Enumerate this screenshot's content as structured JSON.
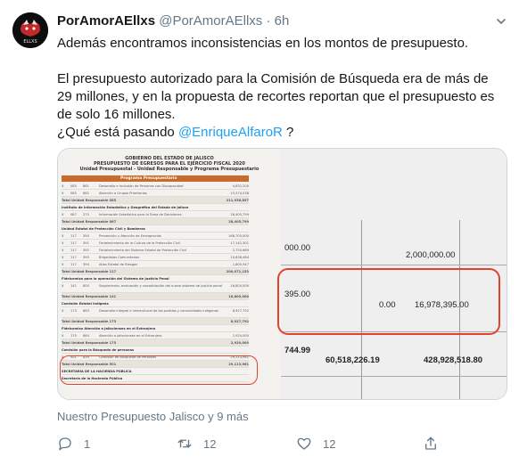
{
  "tweet": {
    "display_name": "PorAmorAEllxs",
    "handle": "@PorAmorAEllxs",
    "separator": "·",
    "time": "6h",
    "avatar_text": "ELLXS",
    "text_line1": "Además encontramos inconsistencias en los montos de presupuesto.",
    "text_line2": "El presupuesto autorizado para la Comisión de Búsqueda era de más de 29 millones, y en la propuesta de recortes reportan que el presupuesto es de solo 16 millones.",
    "text_line3_prefix": "¿Qué está pasando ",
    "mention": "@EnriqueAlfaroR",
    "text_line3_suffix": " ?",
    "footer": "Nuestro Presupuesto Jalisco y 9 más",
    "replies": "1",
    "retweets": "12",
    "likes": "12"
  },
  "document": {
    "title1": "GOBIERNO DEL ESTADO DE JALISCO",
    "title2": "PRESUPUESTO DE EGRESOS PARA EL EJERCICIO FISCAL 2020",
    "title3": "Unidad Presupuestal - Unidad Responsable y Programa Presupuestario",
    "col_header": "Programa Presupuestario",
    "rows": [
      {
        "a": "X",
        "b": "085",
        "c": "861",
        "d": "Desarrollo e Inclusión de Personas con Discapacidad",
        "e": "4,632,200"
      },
      {
        "a": "X",
        "b": "085",
        "c": "862",
        "d": "Atención a Grupos Prioritarios",
        "e": "15,574,538"
      },
      {
        "a": "",
        "b": "",
        "c": "",
        "d": "Total Unidad Responsable 085",
        "e": "211,936,897",
        "type": "total"
      },
      {
        "a": "",
        "b": "",
        "c": "",
        "d": "Instituto de Información Estadística y Geográfica del Estado de Jalisco",
        "e": "",
        "type": "sect"
      },
      {
        "a": "X",
        "b": "087",
        "c": "270",
        "d": "Información Estadística para la Toma de Decisiones",
        "e": "28,405,799"
      },
      {
        "a": "",
        "b": "",
        "c": "",
        "d": "Total Unidad Responsable 087",
        "e": "28,405,799",
        "type": "total"
      },
      {
        "a": "",
        "b": "",
        "c": "",
        "d": "Unidad Estatal de Protección Civil y Bomberos",
        "e": "",
        "type": "sect"
      },
      {
        "a": "X",
        "b": "117",
        "c": "390",
        "d": "Prevención y Atención de Emergencias",
        "e": "168,705,000"
      },
      {
        "a": "X",
        "b": "117",
        "c": "391",
        "d": "Fortalecimiento de la Cultura de la Protección Civil",
        "e": "17,142,301"
      },
      {
        "a": "X",
        "b": "117",
        "c": "392",
        "d": "Fortalecimiento del Sistema Estatal de Protección Civil",
        "e": "2,750,669"
      },
      {
        "a": "X",
        "b": "117",
        "c": "393",
        "d": "Brigadistas Comunitarios",
        "e": "10,838,484"
      },
      {
        "a": "X",
        "b": "117",
        "c": "394",
        "d": "Atlas Estatal de Riesgos",
        "e": "1,805,947"
      },
      {
        "a": "",
        "b": "",
        "c": "",
        "d": "Total Unidad Responsable 117",
        "e": "200,071,153",
        "type": "total"
      },
      {
        "a": "",
        "b": "",
        "c": "",
        "d": "Fideicomiso para la operación del Sistema de Justicia Penal",
        "e": "",
        "type": "sect"
      },
      {
        "a": "X",
        "b": "141",
        "c": "800",
        "d": "Seguimiento, evaluación y consolidación del nuevo sistema de justicia penal",
        "e": "16,800,000"
      },
      {
        "a": "",
        "b": "",
        "c": "",
        "d": "Total Unidad Responsable 141",
        "e": "16,800,000",
        "type": "total"
      },
      {
        "a": "",
        "b": "",
        "c": "",
        "d": "Comisión Estatal Indígena",
        "e": "",
        "type": "sect"
      },
      {
        "a": "X",
        "b": "173",
        "c": "863",
        "d": "Desarrollo integral e intercultural de los pueblos y comunidades indígenas",
        "e": "8,927,792"
      },
      {
        "a": "",
        "b": "",
        "c": "",
        "d": "Total Unidad Responsable 173",
        "e": "8,927,792",
        "type": "total"
      },
      {
        "a": "",
        "b": "",
        "c": "",
        "d": "Fideicomiso Atención a Jaliscienses en el Extranjero",
        "e": "",
        "type": "sect"
      },
      {
        "a": "X",
        "b": "175",
        "c": "864",
        "d": "Atención a jaliscienses en el Extranjero",
        "e": "2,920,000"
      },
      {
        "a": "",
        "b": "",
        "c": "",
        "d": "Total Unidad Responsable 175",
        "e": "2,920,000",
        "type": "total"
      },
      {
        "a": "",
        "b": "",
        "c": "",
        "d": "Comisión para la Búsqueda de personas",
        "e": "",
        "type": "sect"
      },
      {
        "a": "X",
        "b": "501",
        "c": "839",
        "d": "Comisión de Búsqueda de Personas",
        "e": "29,113,961"
      },
      {
        "a": "",
        "b": "",
        "c": "",
        "d": "Total Unidad Responsable 501",
        "e": "29,113,961",
        "type": "total"
      },
      {
        "a": "",
        "b": "",
        "c": "",
        "d": "SECRETARÍA DE LA HACIENDA PÚBLICA",
        "e": "",
        "type": "sect"
      },
      {
        "a": "",
        "b": "",
        "c": "",
        "d": "Secretaría de la Hacienda Pública",
        "e": "",
        "type": "sect"
      }
    ]
  },
  "zoom": {
    "n1": "000.00",
    "n2": "2,000,000.00",
    "n3": "395.00",
    "n4": "0.00",
    "n5": "16,978,395.00",
    "n6": "744.99",
    "n7": "60,518,226.19",
    "n8": "428,928,518.80"
  }
}
